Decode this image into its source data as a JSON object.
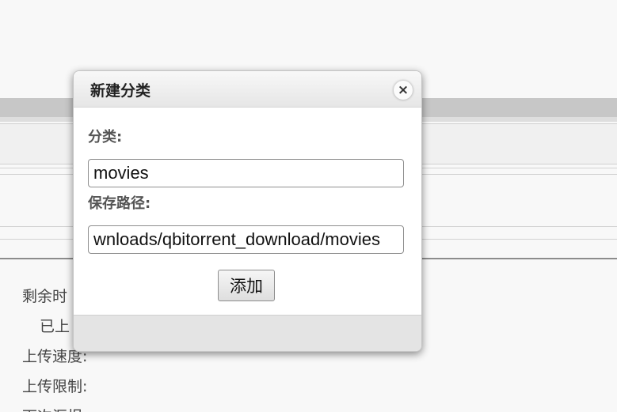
{
  "background": {
    "properties": [
      "剩余时",
      "已上",
      "上传速度:",
      "上传限制:",
      "下次汇报"
    ]
  },
  "dialog": {
    "title": "新建分类",
    "close_icon": "×",
    "category_label": "分类:",
    "category_value": "movies",
    "save_path_label": "保存路径:",
    "save_path_value": "wnloads/qbitorrent_download/movies",
    "add_button": "添加"
  }
}
